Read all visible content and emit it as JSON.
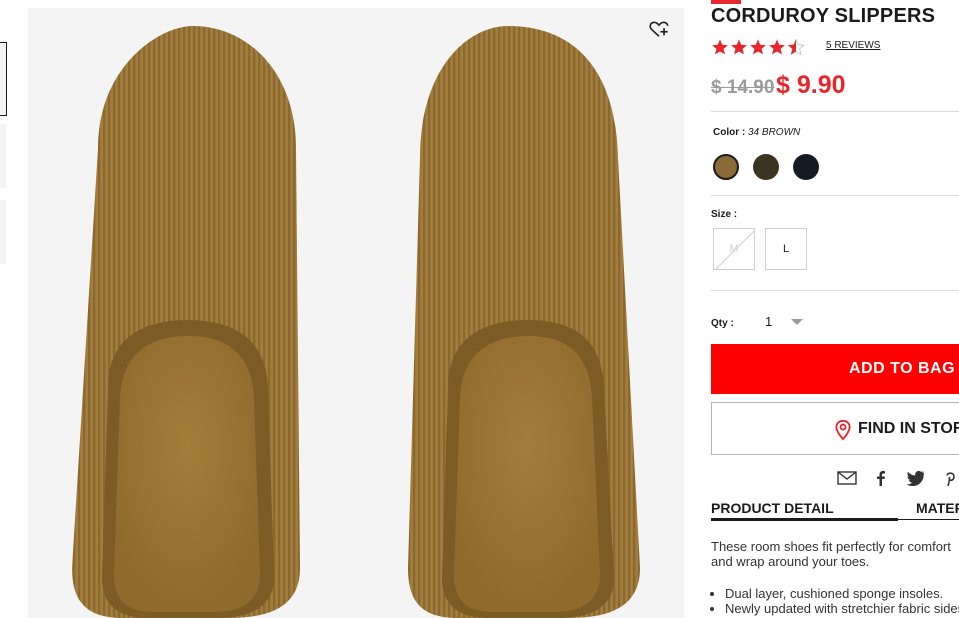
{
  "product": {
    "title": "CORDUROY SLIPPERS",
    "rating": 4.5,
    "reviews_label": "5 REVIEWS",
    "old_price": "$ 14.90",
    "new_price": "$ 9.90"
  },
  "color": {
    "label": "Color :",
    "selected": "34 BROWN",
    "swatches": [
      {
        "name": "brown",
        "hex": "#8a6a35"
      },
      {
        "name": "olive",
        "hex": "#3b3420"
      },
      {
        "name": "navy",
        "hex": "#161a24"
      }
    ]
  },
  "size": {
    "label": "Size :",
    "options": [
      {
        "label": "M",
        "available": false
      },
      {
        "label": "L",
        "available": true
      }
    ]
  },
  "quantity": {
    "label": "Qty :",
    "value": "1"
  },
  "actions": {
    "add_to_bag": "ADD TO BAG",
    "find_in_store": "FIND IN STORE"
  },
  "share_icons": [
    "mail-icon",
    "facebook-icon",
    "twitter-icon",
    "pinterest-icon"
  ],
  "tabs": [
    {
      "label": "PRODUCT DETAIL",
      "active": true
    },
    {
      "label": "MATERIALS",
      "active": false
    }
  ],
  "description": {
    "text": "These room shoes fit perfectly for comfort and wrap around your toes.",
    "bullets": [
      "Dual layer, cushioned sponge insoles.",
      "Newly updated with stretchier fabric sides."
    ]
  },
  "colors": {
    "accent": "#ff0000",
    "price_red": "#e8262d",
    "star_red": "#e8262d"
  }
}
